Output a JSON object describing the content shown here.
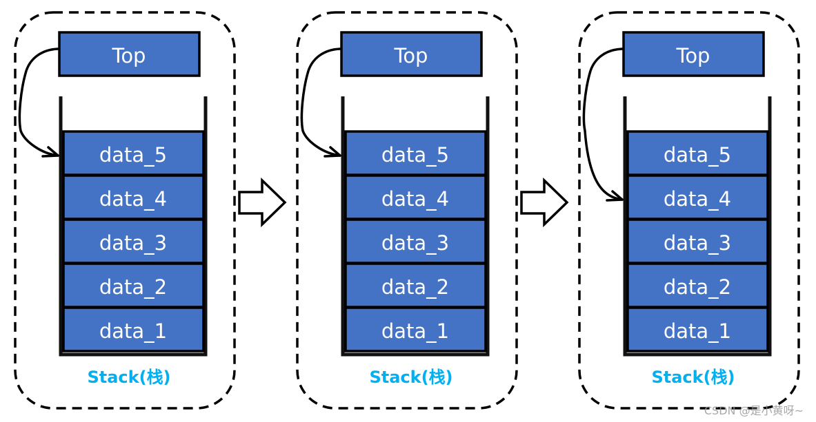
{
  "colors": {
    "cell": "#4472c4",
    "label": "#00b0f0",
    "border": "#000000"
  },
  "panels": [
    {
      "top_label": "Top",
      "cells": [
        "data_5",
        "data_4",
        "data_3",
        "data_2",
        "data_1"
      ],
      "pointer_target": "data_5",
      "stack_label": "Stack(栈)"
    },
    {
      "top_label": "Top",
      "cells": [
        "data_5",
        "data_4",
        "data_3",
        "data_2",
        "data_1"
      ],
      "pointer_target": "data_5",
      "stack_label": "Stack(栈)"
    },
    {
      "top_label": "Top",
      "cells": [
        "data_5",
        "data_4",
        "data_3",
        "data_2",
        "data_1"
      ],
      "pointer_target": "data_4",
      "stack_label": "Stack(栈)"
    }
  ],
  "transitions": [
    "right-arrow",
    "right-arrow"
  ],
  "watermark": "CSDN @是小黄呀~"
}
